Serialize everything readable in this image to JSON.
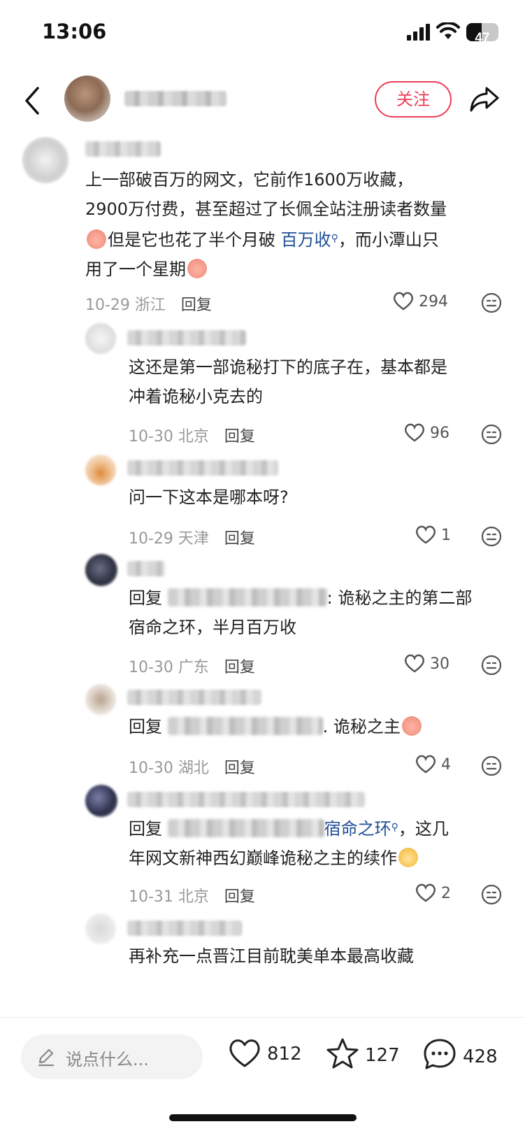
{
  "status_bar": {
    "time": "13:06",
    "battery": "47"
  },
  "header": {
    "follow_label": "关注"
  },
  "comments": [
    {
      "line1": "上一部破百万的网文，它前作1600万收藏，",
      "line2": "2900万付费，甚至超过了长佩全站注册读者数量",
      "line3_a": "但是它也花了半个月破 ",
      "line3_link": "百万收",
      "line3_b": "，而小潭山只",
      "line4": "用了一个星期",
      "date": "10-29 浙江",
      "reply": "回复",
      "likes": "294"
    },
    {
      "line1": "这还是第一部诡秘打下的底子在，基本都是",
      "line2": "冲着诡秘小克去的",
      "date": "10-30 北京",
      "reply": "回复",
      "likes": "96"
    },
    {
      "line1": "问一下这本是哪本呀?",
      "date": "10-29 天津",
      "reply": "回复",
      "likes": "1"
    },
    {
      "prefix": "回复",
      "line1_b": ": 诡秘之主的第二部",
      "line2": "宿命之环，半月百万收",
      "date": "10-30 广东",
      "reply": "回复",
      "likes": "30"
    },
    {
      "prefix": "回复",
      "line1_b": ". 诡秘之主",
      "date": "10-30 湖北",
      "reply": "回复",
      "likes": "4"
    },
    {
      "prefix": "回复",
      "line1_link": "宿命之环",
      "line1_b": "，这几",
      "line2": "年网文新神西幻巅峰诡秘之主的续作",
      "date": "10-31 北京",
      "reply": "回复",
      "likes": "2"
    },
    {
      "line1": "再补充一点晋江目前耽美单本最高收藏"
    }
  ],
  "footer": {
    "input_placeholder": "说点什么...",
    "likes": "812",
    "stars": "127",
    "comments": "428"
  }
}
